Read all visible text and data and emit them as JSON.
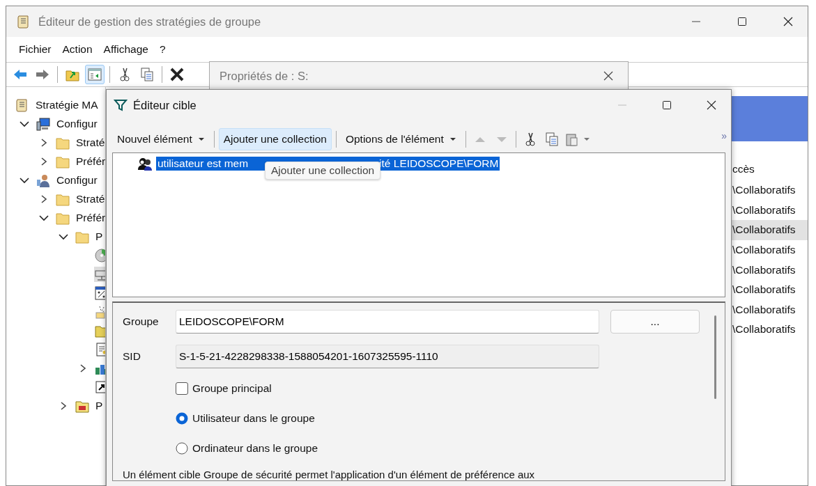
{
  "main_window": {
    "title": "Éditeur de gestion des stratégies de groupe",
    "menu": [
      "Fichier",
      "Action",
      "Affichage",
      "?"
    ],
    "tree": [
      {
        "label": "Stratégie MA",
        "selected": false,
        "children": [
          {
            "label": "Configur",
            "expanded": true,
            "selected": false,
            "children": [
              {
                "label": "Straté",
                "expanded": false,
                "selected": false
              },
              {
                "label": "Préfér",
                "expanded": false,
                "selected": false
              }
            ]
          },
          {
            "label": "Configur",
            "expanded": true,
            "selected": false,
            "children": [
              {
                "label": "Straté",
                "expanded": false,
                "selected": false
              },
              {
                "label": "Préfér",
                "expanded": true,
                "selected": false,
                "children": [
                  {
                    "label": "P",
                    "expanded": true,
                    "selected": false,
                    "children": [
                      {
                        "selected": false
                      },
                      {
                        "selected": true
                      },
                      {
                        "selected": false
                      },
                      {
                        "selected": false
                      },
                      {
                        "selected": false
                      },
                      {
                        "selected": false
                      },
                      {
                        "selected": false,
                        "expanded": false
                      },
                      {
                        "selected": false
                      }
                    ]
                  },
                  {
                    "label": "P",
                    "expanded": false,
                    "selected": false
                  }
                ]
              }
            ]
          }
        ]
      }
    ],
    "right_pane": {
      "column_header": "ccès",
      "rows": [
        {
          "text": "\\Collaboratifs",
          "selected": false
        },
        {
          "text": "\\Collaboratifs",
          "selected": false
        },
        {
          "text": "\\Collaboratifs",
          "selected": true
        },
        {
          "text": "\\Collaboratifs",
          "selected": false
        },
        {
          "text": "\\Collaboratifs",
          "selected": false
        },
        {
          "text": "\\Collaboratifs",
          "selected": false
        },
        {
          "text": "\\Collaboratifs",
          "selected": false
        },
        {
          "text": "\\Collaboratifs",
          "selected": false
        }
      ]
    }
  },
  "properties_dialog": {
    "title": "Propriétés de : S:"
  },
  "target_editor": {
    "title": "Éditeur cible",
    "toolbar": [
      {
        "kind": "dropdown",
        "label": "Nouvel élément",
        "hover": false
      },
      {
        "kind": "button",
        "label": "Ajouter une collection",
        "hover": true
      },
      {
        "kind": "dropdown",
        "label": "Options de l'élément",
        "hover": false
      }
    ],
    "overflow": "»",
    "item": {
      "text_start": "utilisateur est mem",
      "text_end": "ité LEIDOSCOPE\\FORM",
      "selected": true
    },
    "tooltip": "Ajouter une collection",
    "form": {
      "group_label": "Groupe",
      "group_value": "LEIDOSCOPE\\FORM",
      "browse_button": "...",
      "sid_label": "SID",
      "sid_value": "S-1-5-21-4228298338-1588054201-1607325595-1110",
      "checkbox": {
        "label": "Groupe principal",
        "checked": false
      },
      "radios": [
        {
          "label": "Utilisateur dans le groupe",
          "selected": true
        },
        {
          "label": "Ordinateur dans le groupe",
          "selected": false
        }
      ],
      "description": "Un élément cible Groupe de sécurité permet l'application d'un élément de préférence aux"
    }
  }
}
